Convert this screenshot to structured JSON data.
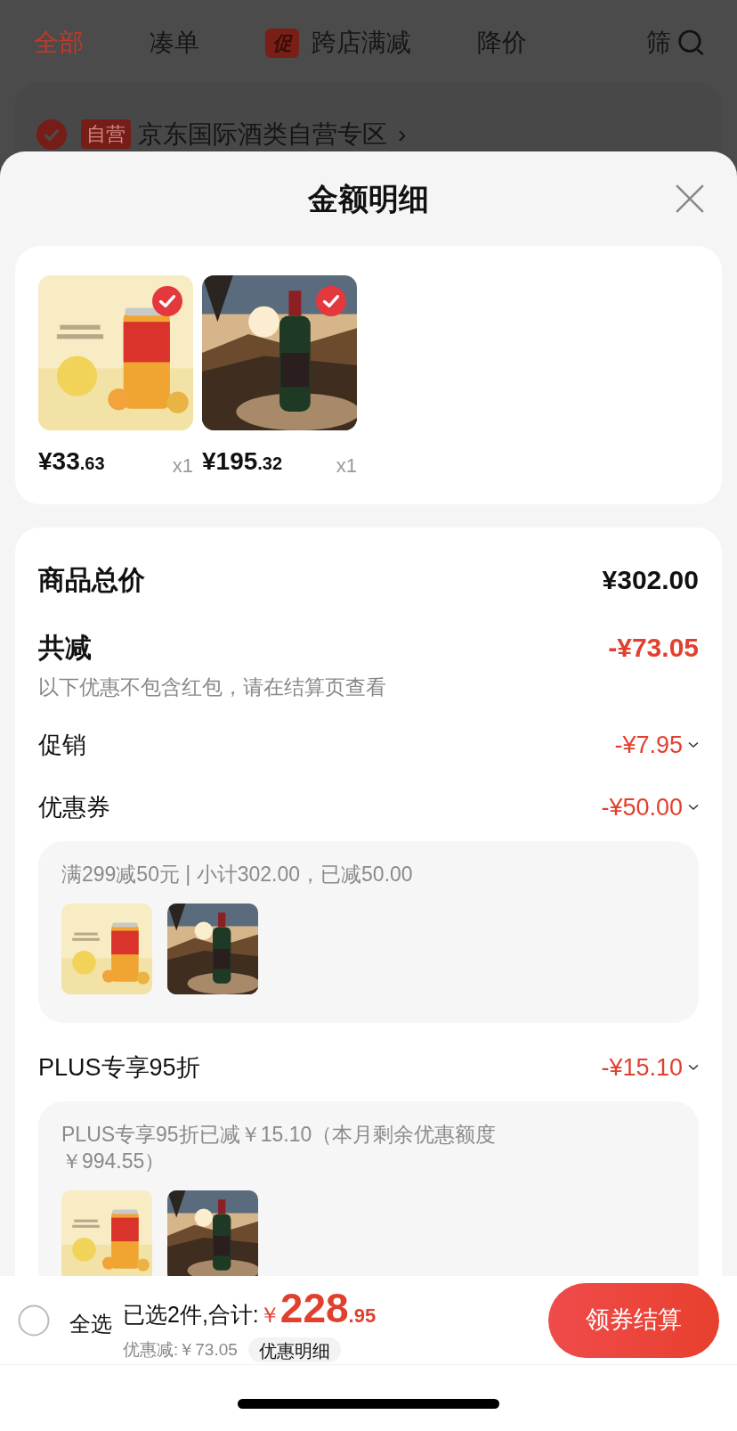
{
  "backdrop": {
    "tabs": [
      {
        "label": "全部",
        "selected": true
      },
      {
        "label": "凑单",
        "selected": false
      },
      {
        "label": "跨店满减",
        "selected": false,
        "badge": "促"
      },
      {
        "label": "降价",
        "selected": false
      },
      {
        "label": "筛",
        "selected": false
      }
    ],
    "shop": {
      "checked": true,
      "badge": "自营",
      "name": "京东国际酒类自营专区",
      "chevron": "›"
    }
  },
  "sheet": {
    "title": "金额明细",
    "products": [
      {
        "kind": "picture",
        "checked": true,
        "price": "¥33.63",
        "quantity": "x1"
      },
      {
        "kind": "picture",
        "checked": true,
        "price": "¥195.32",
        "quantity": "x1"
      }
    ],
    "total": {
      "label": "商品总价",
      "value": "¥302.00"
    },
    "discount": {
      "label": "共减",
      "value": "-¥73.05",
      "note": "以下优惠不包含红包，请在结算页查看"
    },
    "items": [
      {
        "label": "促销",
        "value": "-¥7.95"
      },
      {
        "label": "优惠券",
        "value": "-¥50.00",
        "detail": {
          "text": "满299减50元 | 小计302.00，已减50.00"
        }
      },
      {
        "label": "PLUS专享95折",
        "value": "-¥15.10",
        "detail": {
          "text": "PLUS专享95折已减￥15.10（本月剩余优惠额度￥994.55）"
        }
      }
    ]
  },
  "bottom_bar": {
    "select_all": {
      "label": "全选",
      "checked": false
    },
    "summary": "已选2件,合计:",
    "currency": "￥",
    "amount": "228",
    "cents": ".95",
    "saved": "优惠减:￥73.05",
    "details_button": "优惠明细",
    "checkout_button": "领券结算"
  }
}
